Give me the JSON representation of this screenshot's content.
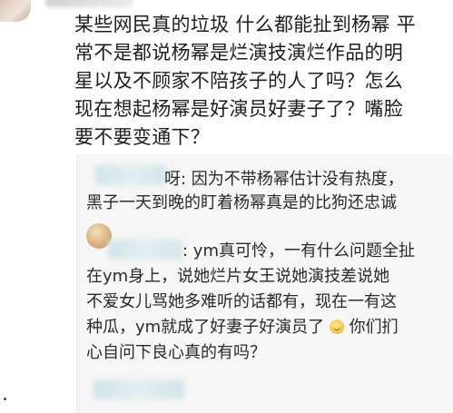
{
  "post": {
    "lines": [
      "某些网民真的垃圾 什么都能扯到杨幂 平",
      "常不是都说杨幂是烂演技演烂作品的明",
      "星以及不顾家不陪孩子的人了吗？怎么",
      "现在想起杨幂是好演员好妻子了？嘴脸",
      "要不要变通下？"
    ]
  },
  "replies": [
    {
      "lines": [
        "呀: 因为不带杨幂估计没有热度，",
        "黑子一天到晚的盯着杨幂真是的比狗还忠诚"
      ]
    },
    {
      "lines": [
        ": ym真可怜，一有什么问题全扯",
        "在ym身上，说她烂片女王说她演技差说她",
        "不爱女儿骂她多难听的话都有，现在一有这",
        "种瓜，ym就成了好妻子好演员了",
        "你们扪",
        "心自问下良心真的有吗？"
      ]
    }
  ]
}
